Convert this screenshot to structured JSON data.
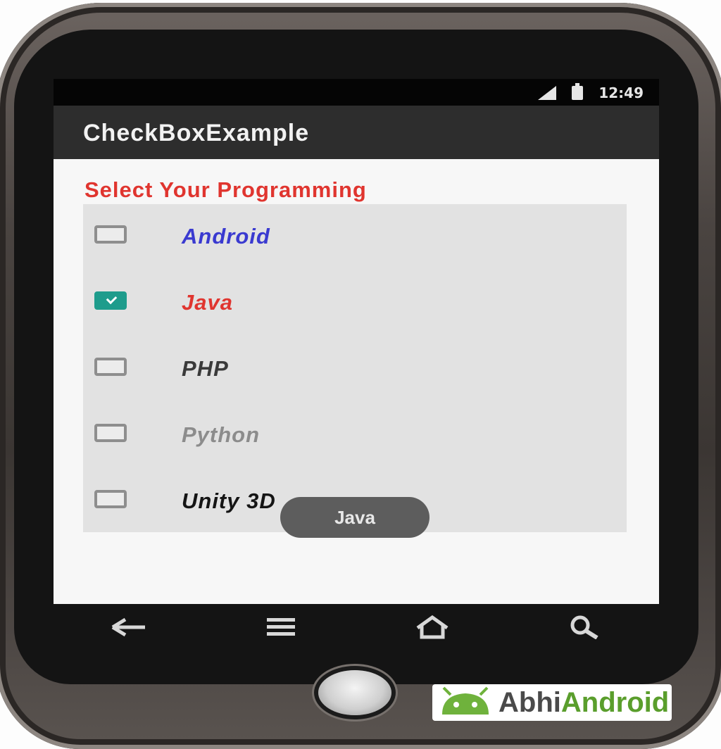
{
  "status_bar": {
    "time": "12:49",
    "icons": [
      "signal-icon",
      "battery-icon"
    ]
  },
  "app_bar": {
    "title": "CheckBoxExample"
  },
  "heading": "Select Your Programming",
  "checkboxes": [
    {
      "label": "Android",
      "checked": false,
      "color": "#3a3ad0"
    },
    {
      "label": "Java",
      "checked": true,
      "color": "#e0352f"
    },
    {
      "label": "PHP",
      "checked": false,
      "color": "#3a3a3a"
    },
    {
      "label": "Python",
      "checked": false,
      "color": "#8c8c8c"
    },
    {
      "label": "Unity 3D",
      "checked": false,
      "color": "#151515"
    }
  ],
  "toast": "Java",
  "nav_buttons": [
    "back-icon",
    "menu-icon",
    "home-icon",
    "search-icon"
  ],
  "colors": {
    "accent": "#1e9c8c",
    "heading": "#e0352f",
    "actionbar": "#2d2d2d"
  },
  "watermark": {
    "prefix": "Abhi",
    "suffix": "Android",
    "text": "AbhiAndroid"
  }
}
